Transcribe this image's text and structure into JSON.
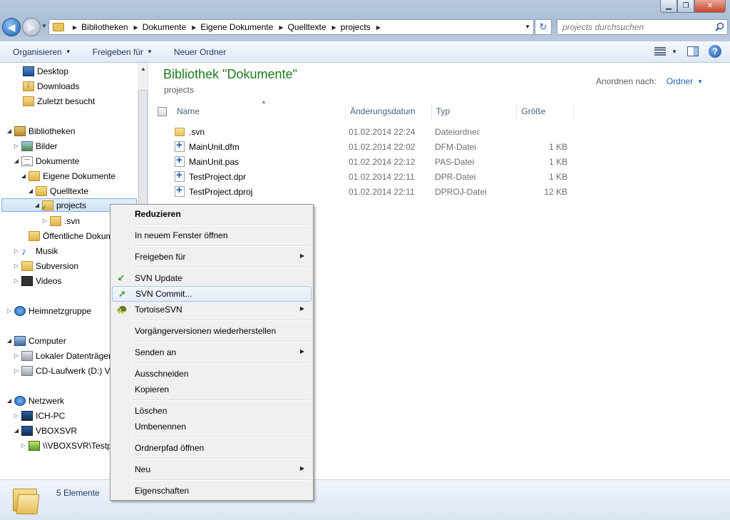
{
  "address": {
    "crumbs": [
      "Bibliotheken",
      "Dokumente",
      "Eigene Dokumente",
      "Quelltexte",
      "projects"
    ],
    "search_placeholder": "projects durchsuchen"
  },
  "toolbar": {
    "organize": "Organisieren",
    "share": "Freigeben für",
    "new_folder": "Neuer Ordner"
  },
  "nav": {
    "items": [
      {
        "label": "Desktop",
        "icon": "desktop-icon"
      },
      {
        "label": "Downloads",
        "icon": "downloads-icon"
      },
      {
        "label": "Zuletzt besucht",
        "icon": "recent-places-icon"
      },
      {
        "label": "Bibliotheken",
        "icon": "libraries-icon"
      },
      {
        "label": "Bilder",
        "icon": "pictures-icon"
      },
      {
        "label": "Dokumente",
        "icon": "documents-icon"
      },
      {
        "label": "Eigene Dokumente",
        "icon": "folder-icon"
      },
      {
        "label": "Quelltexte",
        "icon": "folder-icon"
      },
      {
        "label": "projects",
        "icon": "svn-folder-icon"
      },
      {
        "label": ".svn",
        "icon": "folder-icon"
      },
      {
        "label": "Öffentliche Dokum",
        "icon": "folder-icon"
      },
      {
        "label": "Musik",
        "icon": "music-icon"
      },
      {
        "label": "Subversion",
        "icon": "subversion-icon"
      },
      {
        "label": "Videos",
        "icon": "videos-icon"
      },
      {
        "label": "Heimnetzgruppe",
        "icon": "homegroup-icon"
      },
      {
        "label": "Computer",
        "icon": "computer-icon"
      },
      {
        "label": "Lokaler Datenträger",
        "icon": "local-disk-icon"
      },
      {
        "label": "CD-Laufwerk (D:) Vi",
        "icon": "cd-drive-icon"
      },
      {
        "label": "Netzwerk",
        "icon": "network-icon"
      },
      {
        "label": "ICH-PC",
        "icon": "pc-icon"
      },
      {
        "label": "VBOXSVR",
        "icon": "pc-icon"
      },
      {
        "label": "\\\\VBOXSVR\\Testp",
        "icon": "network-share-icon"
      }
    ]
  },
  "content": {
    "title": "Bibliothek \"Dokumente\"",
    "subtitle": "projects",
    "arrange_label": "Anordnen nach:",
    "arrange_value": "Ordner",
    "columns": [
      "Name",
      "Änderungsdatum",
      "Typ",
      "Größe"
    ],
    "files": [
      {
        "name": ".svn",
        "date": "01.02.2014 22:24",
        "type": "Dateiordner",
        "size": "",
        "icon": "folder-icon"
      },
      {
        "name": "MainUnit.dfm",
        "date": "01.02.2014 22:02",
        "type": "DFM-Datei",
        "size": "1 KB",
        "icon": "delphi-file-icon"
      },
      {
        "name": "MainUnit.pas",
        "date": "01.02.2014 22:12",
        "type": "PAS-Datei",
        "size": "1 KB",
        "icon": "delphi-file-icon"
      },
      {
        "name": "TestProject.dpr",
        "date": "01.02.2014 22:11",
        "type": "DPR-Datei",
        "size": "1 KB",
        "icon": "delphi-file-icon"
      },
      {
        "name": "TestProject.dproj",
        "date": "01.02.2014 22:11",
        "type": "DPROJ-Datei",
        "size": "12 KB",
        "icon": "delphi-file-icon"
      }
    ]
  },
  "status": {
    "count": "5 Elemente"
  },
  "context_menu": {
    "items": [
      {
        "label": "Reduzieren",
        "bold": true
      },
      {
        "label": "In neuem Fenster öffnen"
      },
      {
        "label": "Freigeben für",
        "submenu": true
      },
      {
        "label": "SVN Update",
        "icon": "svn-update-icon"
      },
      {
        "label": "SVN Commit...",
        "icon": "svn-commit-icon",
        "highlighted": true
      },
      {
        "label": "TortoiseSVN",
        "icon": "tortoisesvn-icon",
        "submenu": true
      },
      {
        "label": "Vorgängerversionen wiederherstellen"
      },
      {
        "label": "Senden an",
        "submenu": true
      },
      {
        "label": "Ausschneiden"
      },
      {
        "label": "Kopieren"
      },
      {
        "label": "Löschen"
      },
      {
        "label": "Umbenennen"
      },
      {
        "label": "Ordnerpfad öffnen"
      },
      {
        "label": "Neu",
        "submenu": true
      },
      {
        "label": "Eigenschaften"
      }
    ]
  }
}
